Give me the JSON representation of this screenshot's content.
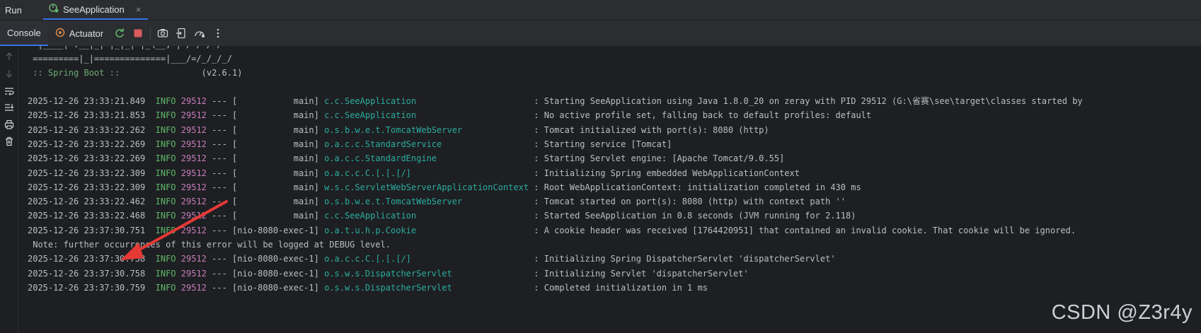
{
  "header": {
    "run_label": "Run",
    "tab_label": "SeeApplication",
    "tab_close": "×"
  },
  "toolbar": {
    "console_label": "Console",
    "actuator_label": "Actuator"
  },
  "banner": {
    "line0": "  |____| .__|_| |_|_| |_\\__, | / / / /",
    "line1": " =========|_|==============|___/=/_/_/_/",
    "spring_label": " :: Spring Boot :: ",
    "spring_version": "               (v2.6.1)"
  },
  "logs": [
    {
      "ts": "2025-12-26 23:33:21.849",
      "level": "INFO",
      "pid": "29512",
      "sep": " --- [",
      "thread": "           main]",
      "logger": "c.c.SeeApplication                      ",
      "msg": " : Starting SeeApplication using Java 1.8.0_20 on zeray with PID 29512 (G:\\省赛\\see\\target\\classes started by"
    },
    {
      "ts": "2025-12-26 23:33:21.853",
      "level": "INFO",
      "pid": "29512",
      "sep": " --- [",
      "thread": "           main]",
      "logger": "c.c.SeeApplication                      ",
      "msg": " : No active profile set, falling back to default profiles: default"
    },
    {
      "ts": "2025-12-26 23:33:22.262",
      "level": "INFO",
      "pid": "29512",
      "sep": " --- [",
      "thread": "           main]",
      "logger": "o.s.b.w.e.t.TomcatWebServer             ",
      "msg": " : Tomcat initialized with port(s): 8080 (http)"
    },
    {
      "ts": "2025-12-26 23:33:22.269",
      "level": "INFO",
      "pid": "29512",
      "sep": " --- [",
      "thread": "           main]",
      "logger": "o.a.c.c.StandardService                 ",
      "msg": " : Starting service [Tomcat]"
    },
    {
      "ts": "2025-12-26 23:33:22.269",
      "level": "INFO",
      "pid": "29512",
      "sep": " --- [",
      "thread": "           main]",
      "logger": "o.a.c.c.StandardEngine                  ",
      "msg": " : Starting Servlet engine: [Apache Tomcat/9.0.55]"
    },
    {
      "ts": "2025-12-26 23:33:22.309",
      "level": "INFO",
      "pid": "29512",
      "sep": " --- [",
      "thread": "           main]",
      "logger": "o.a.c.c.C.[.[.[/]                       ",
      "msg": " : Initializing Spring embedded WebApplicationContext"
    },
    {
      "ts": "2025-12-26 23:33:22.309",
      "level": "INFO",
      "pid": "29512",
      "sep": " --- [",
      "thread": "           main]",
      "logger": "w.s.c.ServletWebServerApplicationContext",
      "msg": " : Root WebApplicationContext: initialization completed in 430 ms"
    },
    {
      "ts": "2025-12-26 23:33:22.462",
      "level": "INFO",
      "pid": "29512",
      "sep": " --- [",
      "thread": "           main]",
      "logger": "o.s.b.w.e.t.TomcatWebServer             ",
      "msg": " : Tomcat started on port(s): 8080 (http) with context path ''"
    },
    {
      "ts": "2025-12-26 23:33:22.468",
      "level": "INFO",
      "pid": "29512",
      "sep": " --- [",
      "thread": "           main]",
      "logger": "c.c.SeeApplication                      ",
      "msg": " : Started SeeApplication in 0.8 seconds (JVM running for 2.118)"
    },
    {
      "ts": "2025-12-26 23:37:30.751",
      "level": "INFO",
      "pid": "29512",
      "sep": " --- [",
      "thread": "nio-8080-exec-1]",
      "logger": "o.a.t.u.h.p.Cookie                      ",
      "msg": " : A cookie header was received [1764420951] that contained an invalid cookie. That cookie will be ignored."
    },
    {
      "plain": " Note: further occurrences of this error will be logged at DEBUG level."
    },
    {
      "ts": "2025-12-26 23:37:30.758",
      "level": "INFO",
      "pid": "29512",
      "sep": " --- [",
      "thread": "nio-8080-exec-1]",
      "logger": "o.a.c.c.C.[.[.[/]                       ",
      "msg": " : Initializing Spring DispatcherServlet 'dispatcherServlet'"
    },
    {
      "ts": "2025-12-26 23:37:30.758",
      "level": "INFO",
      "pid": "29512",
      "sep": " --- [",
      "thread": "nio-8080-exec-1]",
      "logger": "o.s.w.s.DispatcherServlet               ",
      "msg": " : Initializing Servlet 'dispatcherServlet'"
    },
    {
      "ts": "2025-12-26 23:37:30.759",
      "level": "INFO",
      "pid": "29512",
      "sep": " --- [",
      "thread": "nio-8080-exec-1]",
      "logger": "o.s.w.s.DispatcherServlet               ",
      "msg": " : Completed initialization in 1 ms"
    }
  ],
  "watermark": "CSDN @Z3r4y",
  "colors": {
    "background": "#1e1f22",
    "panel": "#2b2d30",
    "accent": "#3574f0",
    "info": "#5fb96a",
    "pid": "#c77dbb",
    "logger": "#2aaca0",
    "arrow": "#e53935"
  }
}
